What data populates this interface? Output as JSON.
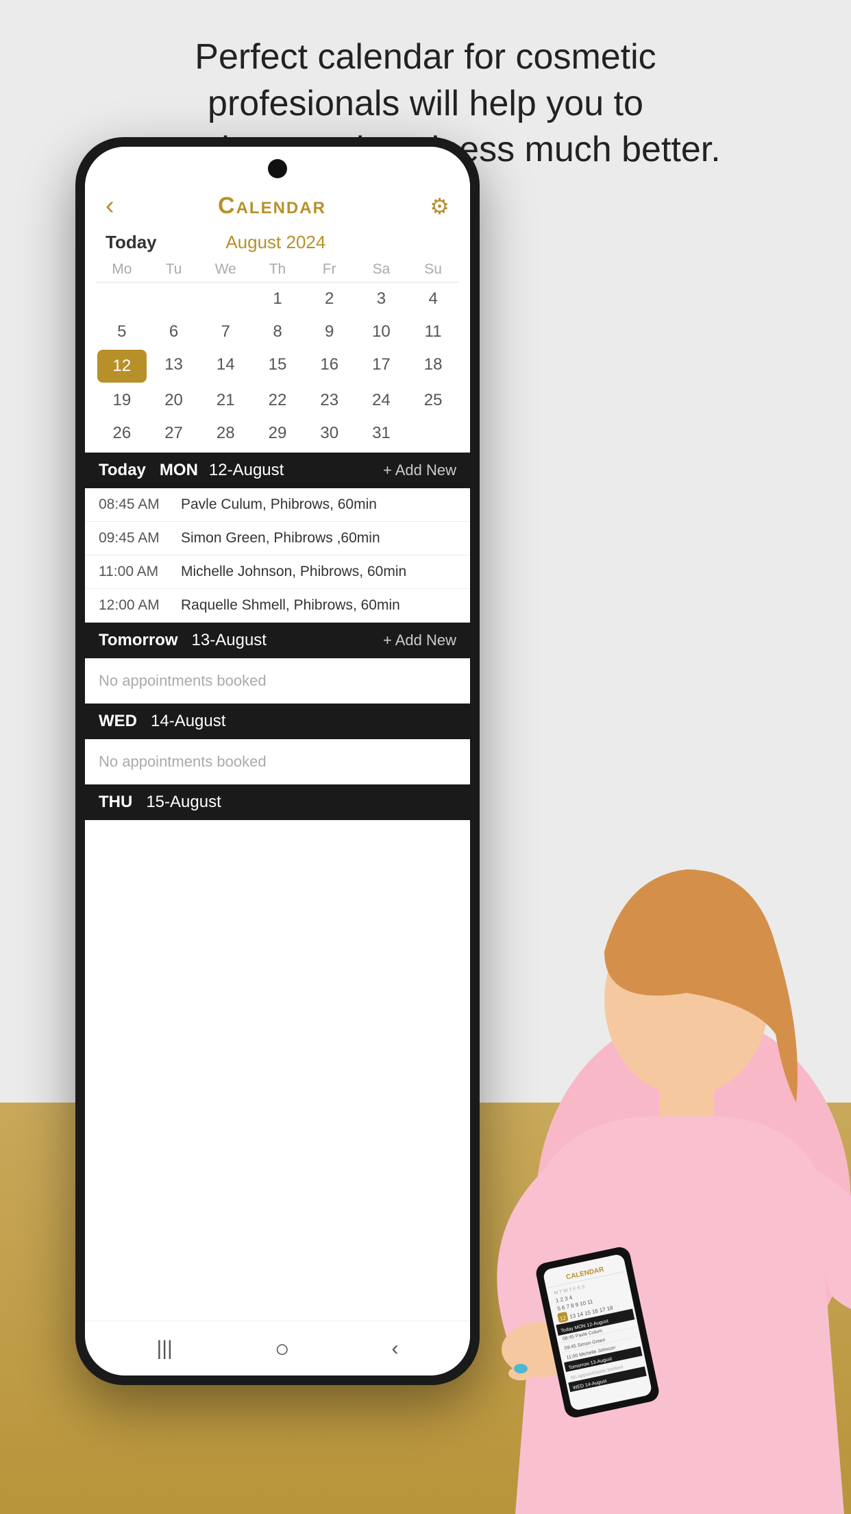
{
  "tagline": {
    "line1": "Perfect calendar for cosmetic",
    "line2": "profesionals will help you to",
    "line3": "organize your bussiness much better."
  },
  "header": {
    "title": "Calendar",
    "back_label": "‹",
    "settings_icon": "⚙"
  },
  "calendar": {
    "today_label": "Today",
    "month_label": "August 2024",
    "day_headers": [
      "Mo",
      "Tu",
      "We",
      "Th",
      "Fr",
      "Sa",
      "Su"
    ],
    "weeks": [
      [
        "",
        "",
        "",
        "1",
        "2",
        "3",
        "4"
      ],
      [
        "5",
        "6",
        "7",
        "8",
        "9",
        "10",
        "11"
      ],
      [
        "12",
        "13",
        "14",
        "15",
        "16",
        "17",
        "18"
      ],
      [
        "19",
        "20",
        "21",
        "22",
        "23",
        "24",
        "25"
      ],
      [
        "26",
        "27",
        "28",
        "29",
        "30",
        "31",
        ""
      ]
    ],
    "selected_day": "12"
  },
  "schedule": {
    "sections": [
      {
        "label": "Today",
        "day": "MON",
        "date": "12-August",
        "add_label": "+ Add New",
        "appointments": [
          {
            "time": "08:45 AM",
            "detail": "Pavle Culum, Phibrows, 60min"
          },
          {
            "time": "09:45 AM",
            "detail": "Simon Green, Phibrows ,60min"
          },
          {
            "time": "11:00 AM",
            "detail": "Michelle Johnson, Phibrows, 60min"
          },
          {
            "time": "12:00 AM",
            "detail": "Raquelle Shmell, Phibrows, 60min"
          }
        ],
        "empty": false
      },
      {
        "label": "Tomorrow",
        "day": "",
        "date": "13-August",
        "add_label": "+ Add New",
        "appointments": [],
        "empty": true,
        "empty_text": "No appointments booked"
      },
      {
        "label": "WED",
        "day": "",
        "date": "14-August",
        "add_label": "",
        "appointments": [],
        "empty": true,
        "empty_text": "No appointments booked"
      },
      {
        "label": "THU",
        "day": "",
        "date": "15-August",
        "add_label": "",
        "appointments": [],
        "empty": true,
        "empty_text": ""
      }
    ]
  },
  "bottom_nav": {
    "items": [
      "|||",
      "○",
      "‹"
    ]
  },
  "colors": {
    "gold": "#b8902a",
    "dark": "#1a1a1a",
    "white": "#ffffff",
    "light_gray": "#f0f0f0",
    "text_gray": "#aaaaaa"
  }
}
